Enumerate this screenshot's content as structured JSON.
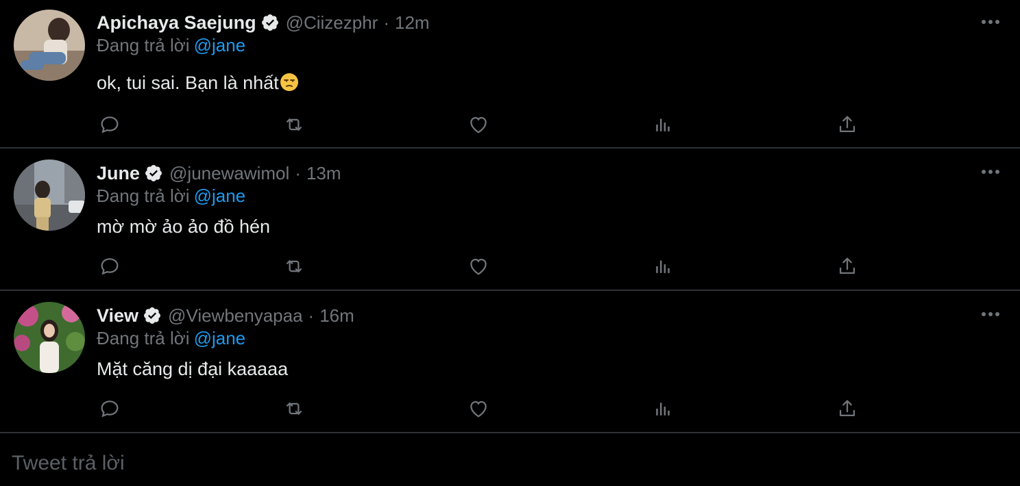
{
  "colors": {
    "background": "#000000",
    "text": "#e7e9ea",
    "muted": "#71767b",
    "accent": "#1d9bf0",
    "divider": "#2f3336"
  },
  "tweets": [
    {
      "name": "Apichaya Saejung",
      "handle": "@Ciizezphr",
      "separator": "·",
      "time": "12m",
      "reply_prefix": "Đang trả lời",
      "reply_to": "@jane",
      "text": "ok, tui sai. Bạn là nhất",
      "emoji": "unamused-face-emoji"
    },
    {
      "name": "June",
      "handle": "@junewawimol",
      "separator": "·",
      "time": "13m",
      "reply_prefix": "Đang trả lời",
      "reply_to": "@jane",
      "text": "mờ mờ ảo ảo đồ hén"
    },
    {
      "name": "View",
      "handle": "@Viewbenyapaa",
      "separator": "·",
      "time": "16m",
      "reply_prefix": "Đang trả lời",
      "reply_to": "@jane",
      "text": "Mặt căng dị đại kaaaaa"
    }
  ],
  "icons": [
    "reply-icon",
    "retweet-icon",
    "like-icon",
    "analytics-icon",
    "share-icon",
    "more-icon",
    "verified-badge-icon"
  ],
  "composer": {
    "placeholder": "Tweet trả lời"
  }
}
